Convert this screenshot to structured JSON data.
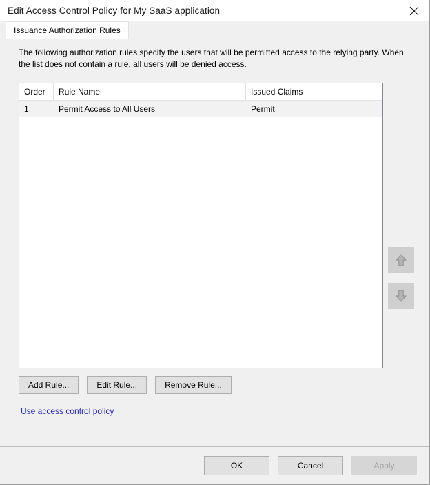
{
  "window": {
    "title": "Edit Access Control Policy for My SaaS application",
    "close_icon": "close-icon",
    "close_glyph": "✕"
  },
  "tabs": [
    {
      "label": "Issuance Authorization Rules",
      "selected": true
    }
  ],
  "main": {
    "description": "The following authorization rules specify the users that will be permitted access to the relying party. When the list does not contain a rule, all users will be denied access.",
    "list": {
      "columns": [
        "Order",
        "Rule Name",
        "Issued Claims"
      ],
      "rows": [
        {
          "order": "1",
          "rule_name": "Permit Access to All Users",
          "issued_claims": "Permit",
          "selected": true
        }
      ]
    },
    "order_buttons": [
      {
        "name": "move-up-button",
        "icon": "arrow-up-icon",
        "enabled": false
      },
      {
        "name": "move-down-button",
        "icon": "arrow-down-icon",
        "enabled": false
      }
    ],
    "actions": [
      {
        "label": "Add Rule...",
        "enabled": true
      },
      {
        "label": "Edit Rule...",
        "enabled": true
      },
      {
        "label": "Remove Rule...",
        "enabled": true
      }
    ],
    "policy_link": "Use access control policy"
  },
  "footer": {
    "ok_label": "OK",
    "cancel_label": "Cancel",
    "apply_label": "Apply",
    "apply_enabled": false
  },
  "colors": {
    "dialog_bg": "#f0f0f0",
    "titlebar_bg": "#ffffff",
    "link": "#2b2bd4",
    "selected_row": "#f2f2f2",
    "button_face": "#e1e1e1",
    "disabled_text": "#a0a0a0"
  }
}
